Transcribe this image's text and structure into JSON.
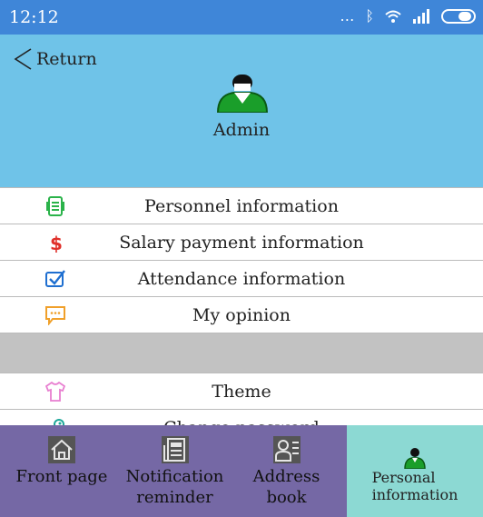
{
  "status_bar": {
    "time": "12:12",
    "icons": [
      "more-icon",
      "bluetooth-icon",
      "wifi-icon",
      "signal-icon",
      "battery-icon"
    ]
  },
  "header": {
    "return_label": "Return",
    "user_name": "Admin",
    "user_icon": "user-avatar-icon"
  },
  "menu": {
    "personnel": "Personnel information",
    "salary": "Salary payment information",
    "attendance": "Attendance information",
    "opinion": "My opinion",
    "theme": "Theme",
    "password": "Change password"
  },
  "tabs": {
    "front_page": "Front page",
    "notification": "Notification\nreminder",
    "address_book": "Address\nbook",
    "personal": "Personal\ninformation"
  },
  "colors": {
    "status_bar": "#3f86d8",
    "header": "#6fc3e8",
    "tabbar": "#7568a5",
    "active_tab": "#8cd9d3",
    "separator": "#c2c2c2"
  }
}
